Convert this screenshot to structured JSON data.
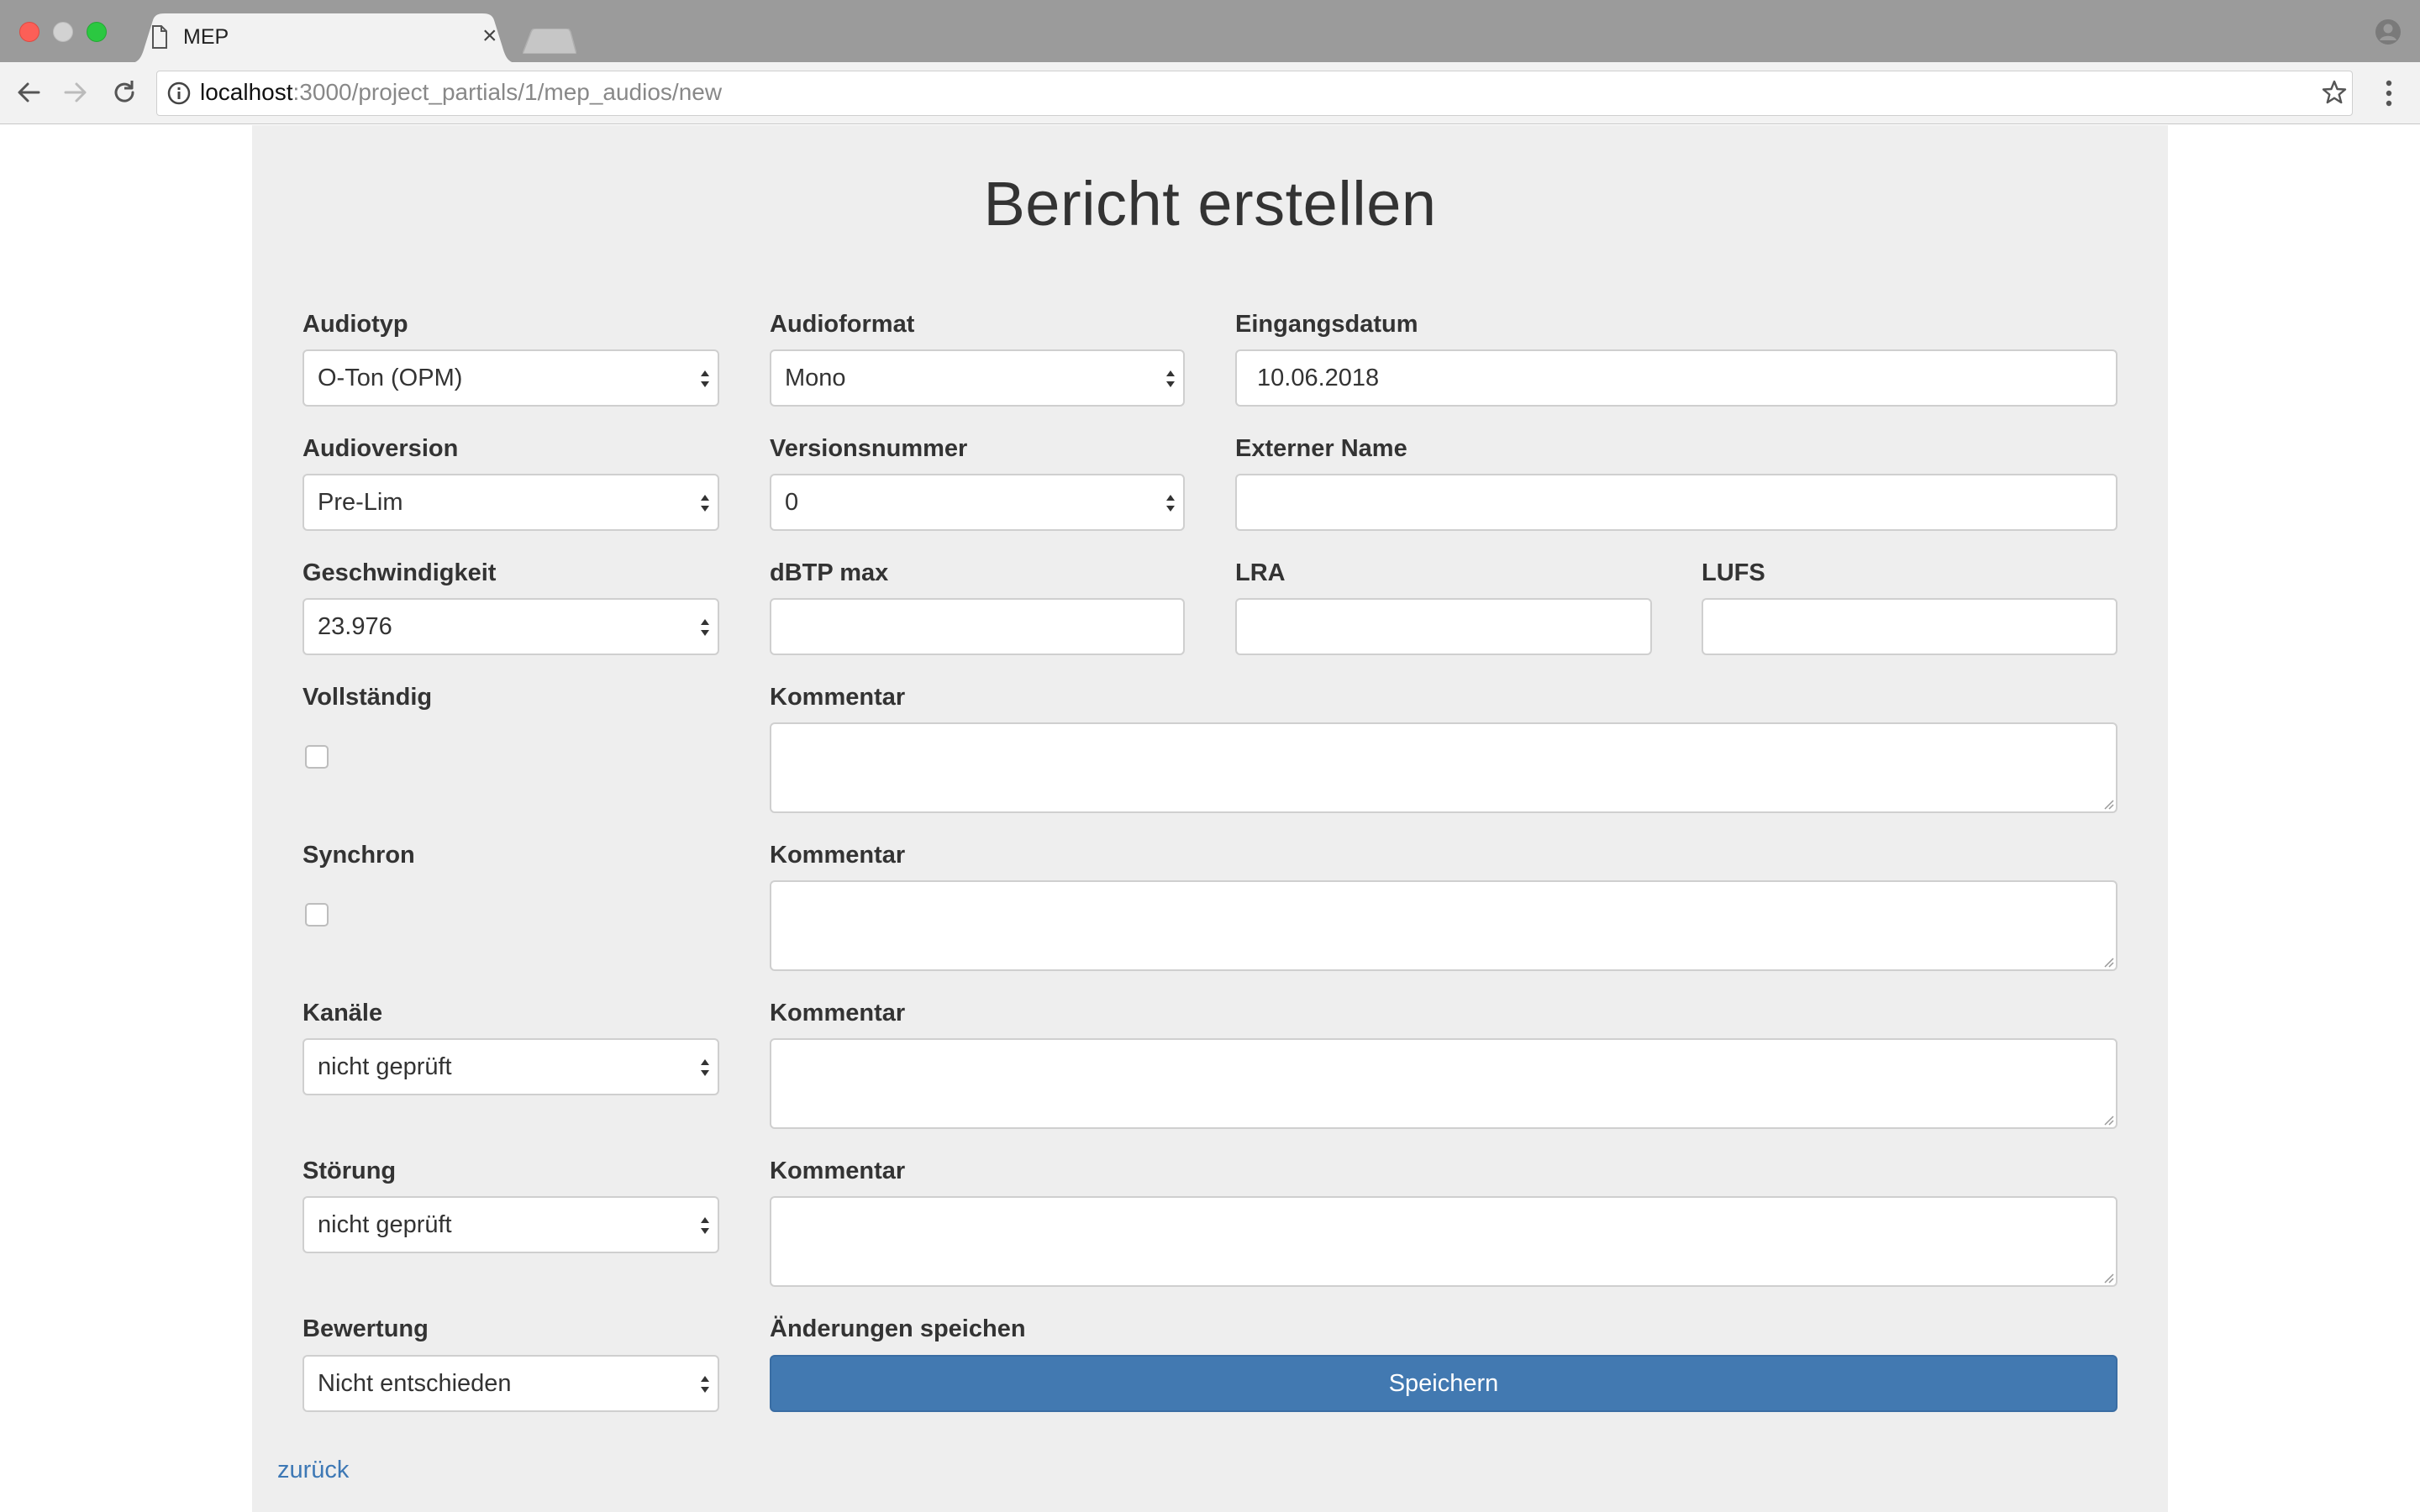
{
  "browser": {
    "tab_title": "MEP",
    "tab_close": "×",
    "url_host": "localhost",
    "url_rest": ":3000/project_partials/1/mep_audios/new"
  },
  "page": {
    "title": "Bericht erstellen",
    "back_link": "zurück"
  },
  "form": {
    "audiotyp": {
      "label": "Audiotyp",
      "value": "O-Ton (OPM)"
    },
    "audioformat": {
      "label": "Audioformat",
      "value": "Mono"
    },
    "eingangsdatum": {
      "label": "Eingangsdatum",
      "value": "10.06.2018"
    },
    "audioversion": {
      "label": "Audioversion",
      "value": "Pre-Lim"
    },
    "versionsnummer": {
      "label": "Versionsnummer",
      "value": "0"
    },
    "externer_name": {
      "label": "Externer Name",
      "value": ""
    },
    "geschwindigkeit": {
      "label": "Geschwindigkeit",
      "value": "23.976"
    },
    "dbtp_max": {
      "label": "dBTP max",
      "value": ""
    },
    "lra": {
      "label": "LRA",
      "value": ""
    },
    "lufs": {
      "label": "LUFS",
      "value": ""
    },
    "vollstaendig": {
      "label": "Vollständig",
      "checked": false,
      "comment_label": "Kommentar"
    },
    "synchron": {
      "label": "Synchron",
      "checked": false,
      "comment_label": "Kommentar"
    },
    "kanaele": {
      "label": "Kanäle",
      "value": "nicht geprüft",
      "comment_label": "Kommentar"
    },
    "stoerung": {
      "label": "Störung",
      "value": "nicht geprüft",
      "comment_label": "Kommentar"
    },
    "bewertung": {
      "label": "Bewertung",
      "value": "Nicht entschieden"
    },
    "save": {
      "label": "Änderungen speichen",
      "button": "Speichern"
    }
  },
  "colors": {
    "button_blue": "#4279b1",
    "link_blue": "#3d78b5",
    "panel_gray": "#eeeeee"
  }
}
